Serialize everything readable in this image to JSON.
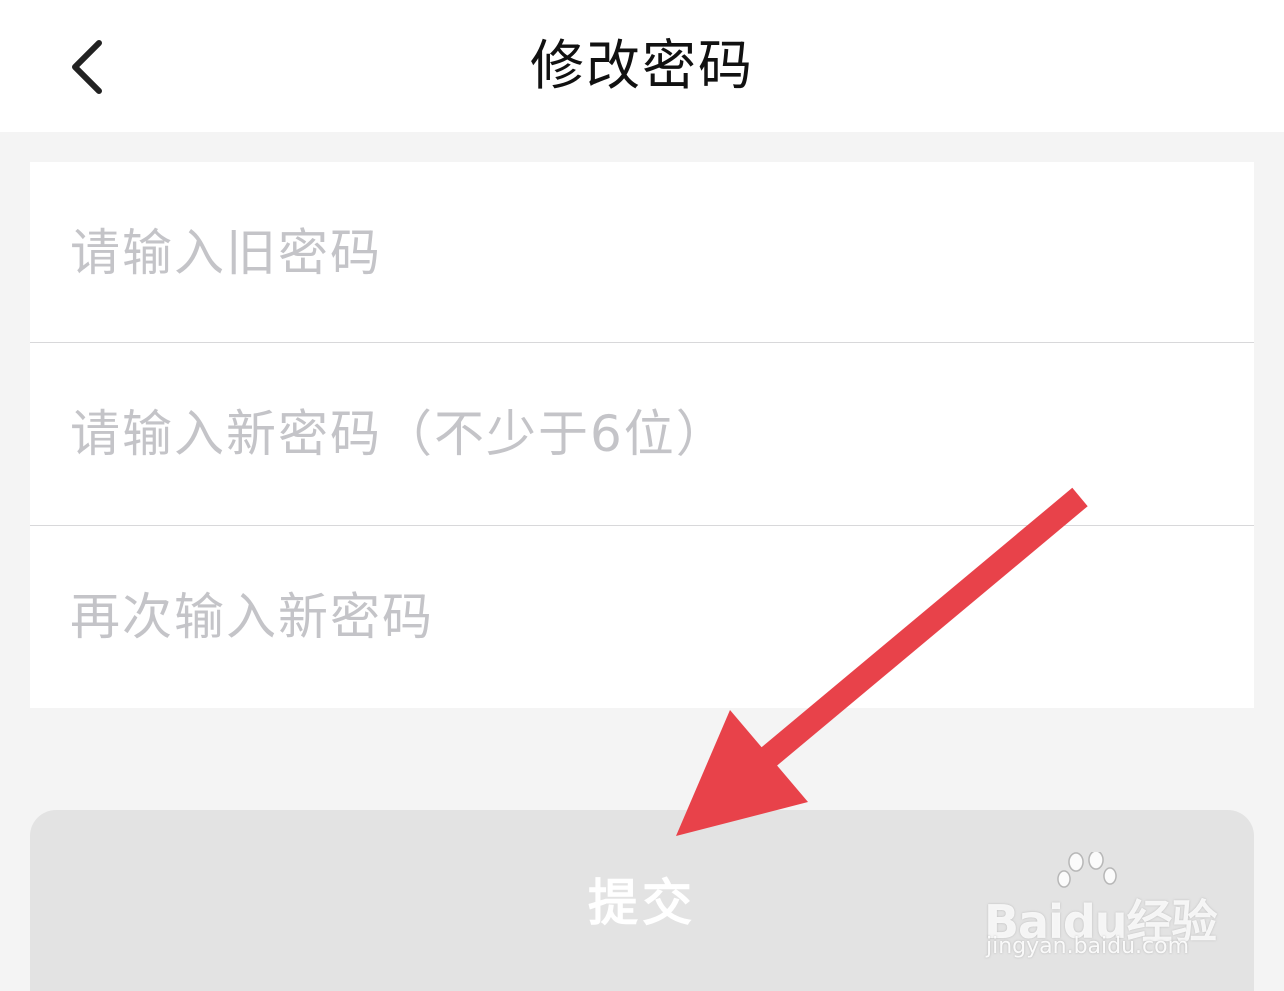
{
  "header": {
    "title": "修改密码",
    "back_icon": "chevron-left-icon"
  },
  "form": {
    "old_password": {
      "value": "",
      "placeholder": "请输入旧密码"
    },
    "new_password": {
      "value": "",
      "placeholder": "请输入新密码（不少于6位）"
    },
    "confirm_password": {
      "value": "",
      "placeholder": "再次输入新密码"
    }
  },
  "submit": {
    "label": "提交",
    "state": "disabled"
  },
  "annotation": {
    "color": "#e8424a",
    "icon": "arrow-pointer-icon"
  },
  "watermark": {
    "logo": "Baidu经验",
    "url": "jingyan.baidu.com"
  },
  "colors": {
    "background": "#f4f4f4",
    "card": "#ffffff",
    "placeholder": "#c4c4c8",
    "button_disabled": "#e3e3e3",
    "button_text": "#ffffff"
  }
}
